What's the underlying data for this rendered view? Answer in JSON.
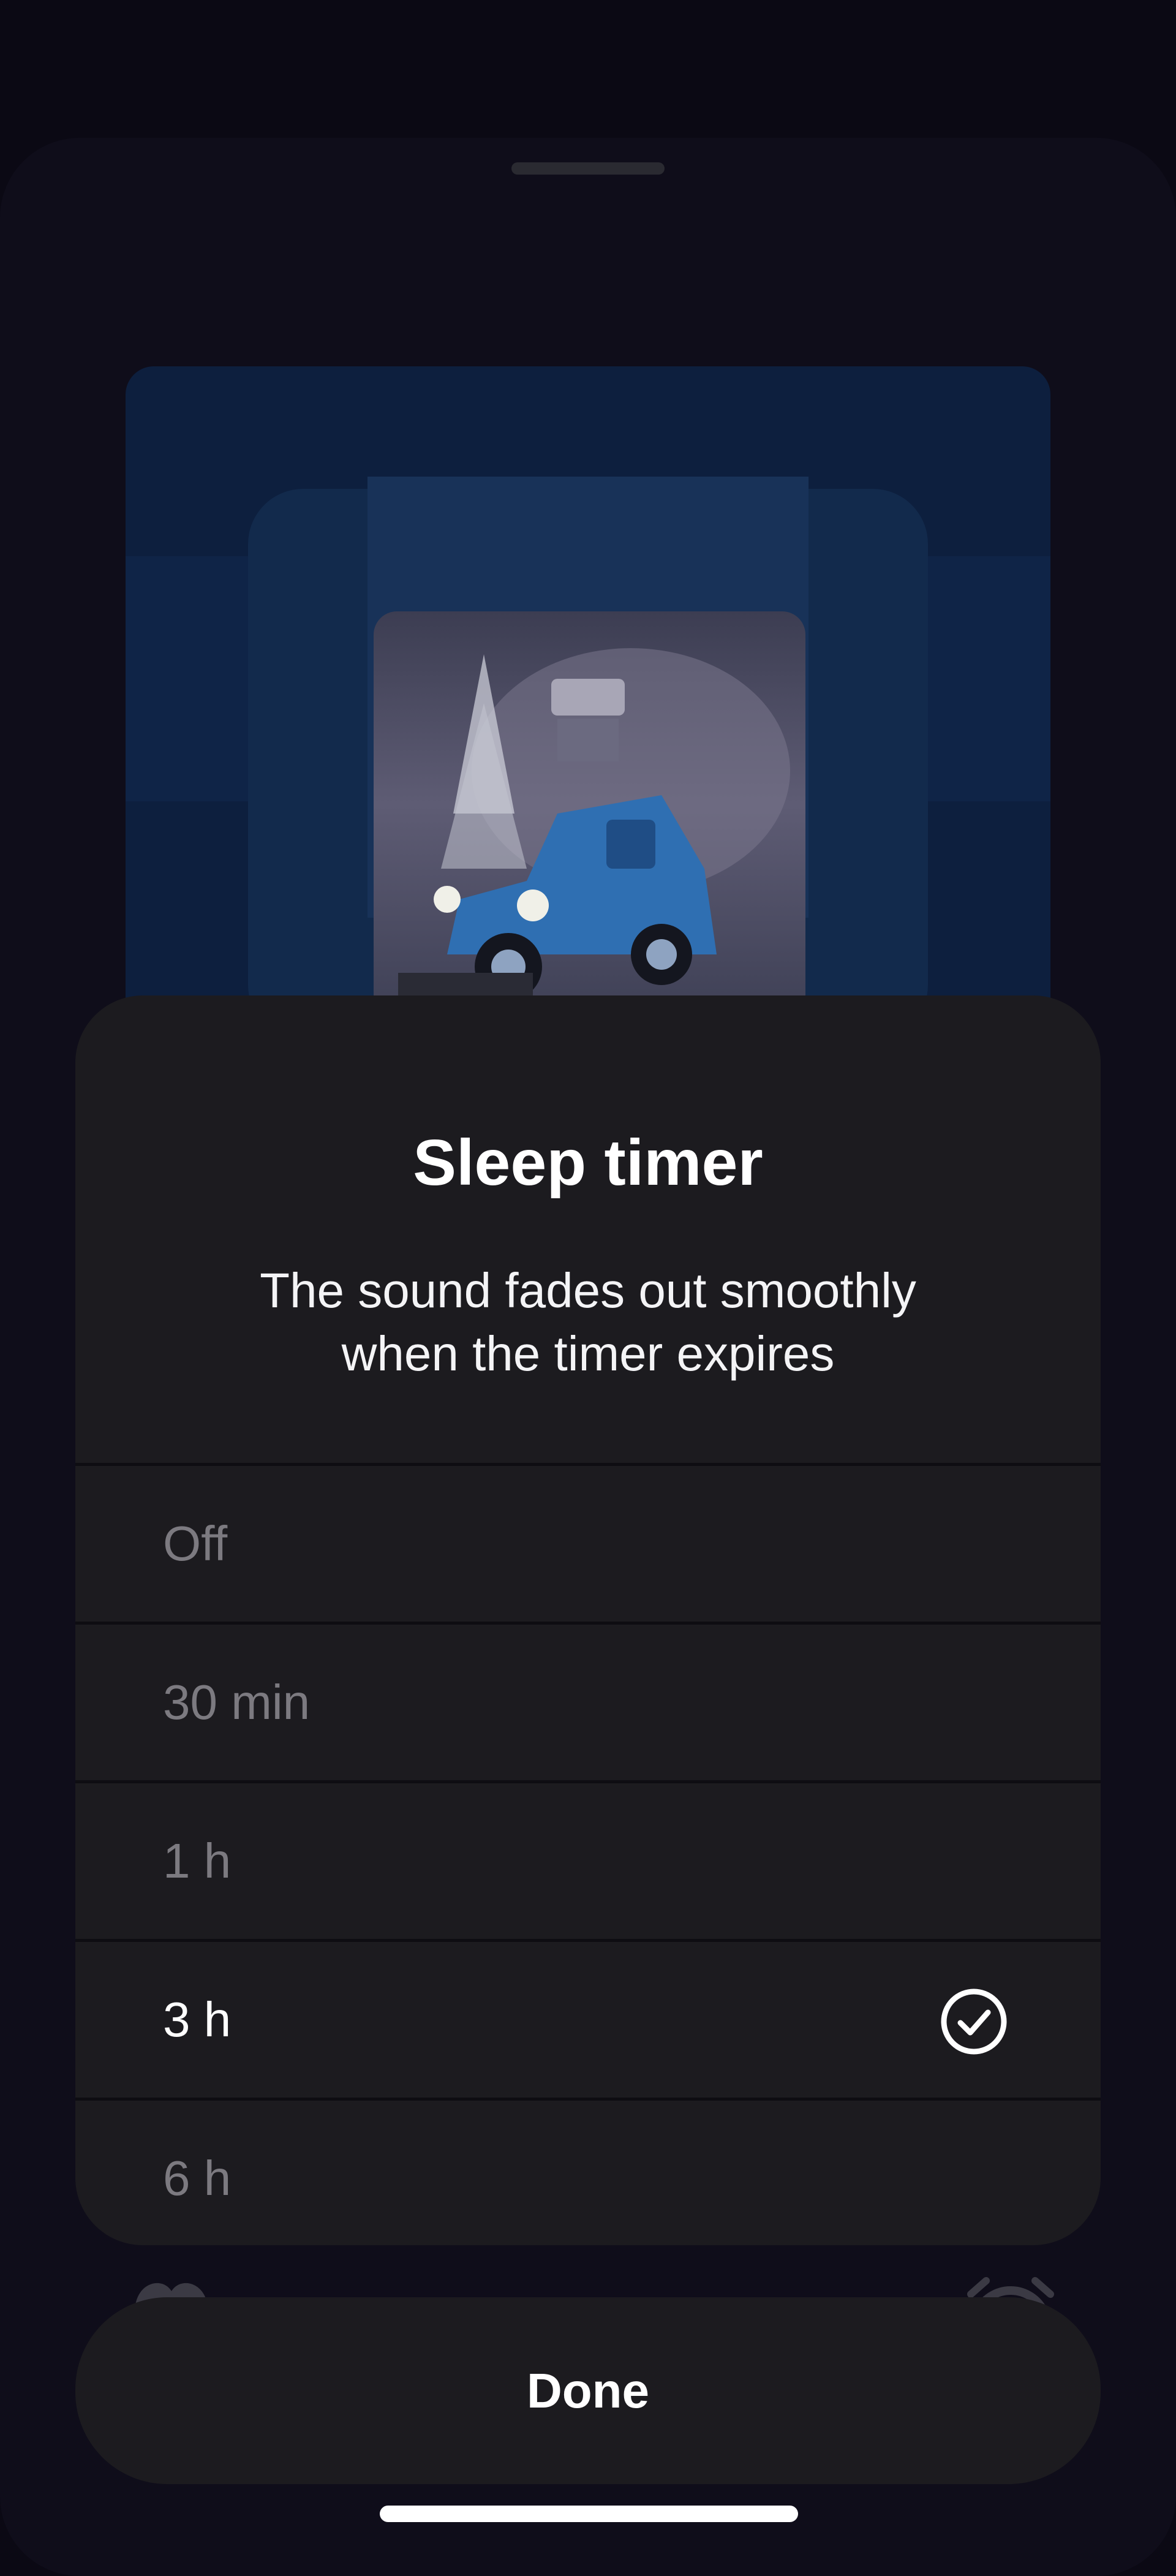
{
  "sheet": {
    "title": "Sleep timer",
    "description_line1": "The sound fades out smoothly",
    "description_line2": "when the timer expires"
  },
  "options": [
    {
      "label": "Off",
      "selected": false
    },
    {
      "label": "30 min",
      "selected": false
    },
    {
      "label": "1 h",
      "selected": false
    },
    {
      "label": "3 h",
      "selected": true
    },
    {
      "label": "6 h",
      "selected": false
    }
  ],
  "done_label": "Done",
  "icons": {
    "selected": "check-circle-icon",
    "background_left": "heart-icon",
    "background_right": "alarm-icon"
  },
  "colors": {
    "background": "#0b0914",
    "sheet": "#1c1b1f",
    "text_primary": "#ffffff",
    "text_muted": "#7c7a80",
    "artwork_blue": "#0d1f3e"
  }
}
